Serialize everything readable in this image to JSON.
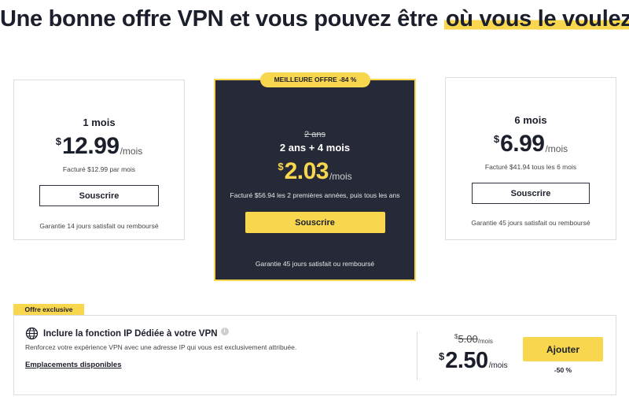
{
  "headline": {
    "part1": "Une bonne offre VPN et vous pouvez être ",
    "highlight": "où vous le voulez"
  },
  "plans": [
    {
      "term": "1 mois",
      "currency": "$",
      "price": "12.99",
      "per": "/mois",
      "billed": "Facturé $12.99 par mois",
      "button": "Souscrire",
      "guarantee": "Garantie 14 jours satisfait ou remboursé"
    },
    {
      "badge": "MEILLEURE OFFRE -84 %",
      "old_term": "2 ans",
      "term": "2 ans + 4 mois",
      "currency": "$",
      "price": "2.03",
      "per": "/mois",
      "billed": "Facturé $56.94 les 2 premières années, puis tous les ans",
      "button": "Souscrire",
      "guarantee": "Garantie 45 jours satisfait ou remboursé"
    },
    {
      "term": "6 mois",
      "currency": "$",
      "price": "6.99",
      "per": "/mois",
      "billed": "Facturé $41.94 tous les 6 mois",
      "button": "Souscrire",
      "guarantee": "Garantie 45 jours satisfait ou remboursé"
    }
  ],
  "addon": {
    "tag": "Offre exclusive",
    "title": "Inclure la fonction IP Dédiée à votre VPN",
    "description": "Renforcez votre expérience VPN avec une adresse IP qui vous est exclusivement attribuée.",
    "link": "Emplacements disponibles",
    "old_currency": "$",
    "old_price": "5.00",
    "old_per": "/mois",
    "currency": "$",
    "price": "2.50",
    "per": "/mois",
    "button": "Ajouter",
    "discount": "-50 %"
  },
  "colors": {
    "accent": "#f8d64e",
    "dark": "#262a38",
    "text": "#1b1e2b"
  },
  "icons": {
    "globe": "globe-icon",
    "info": "info-icon"
  }
}
